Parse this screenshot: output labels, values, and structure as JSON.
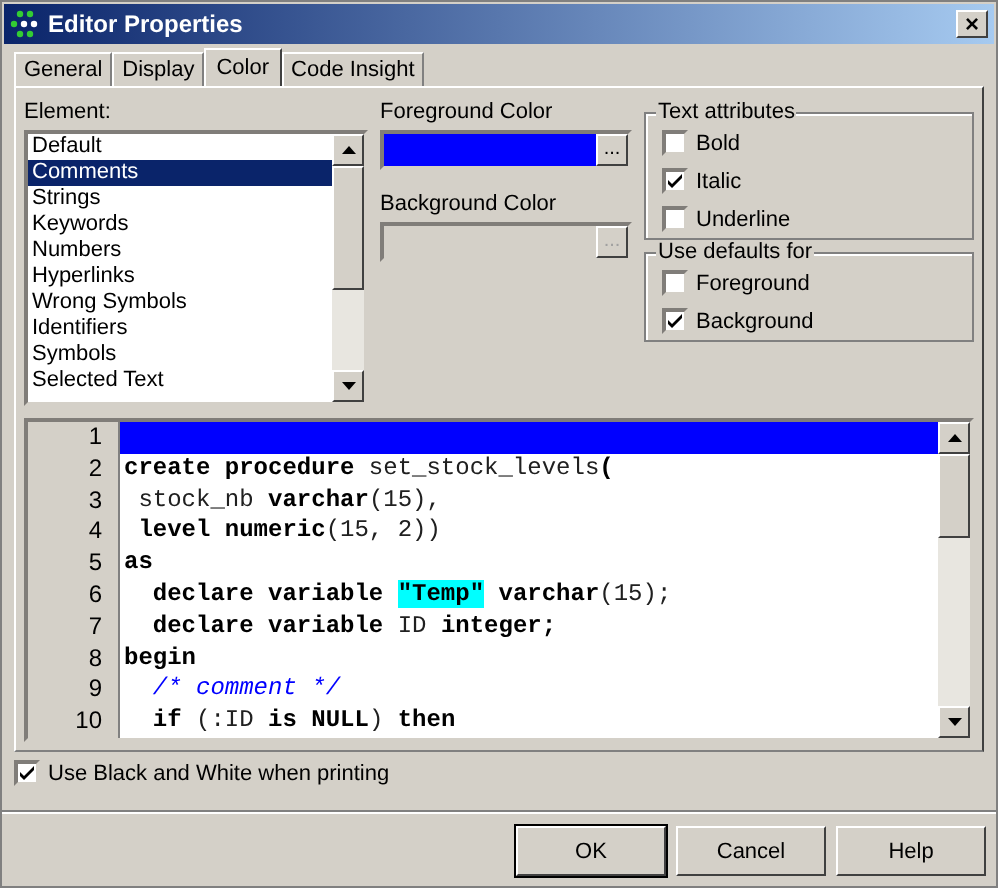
{
  "window": {
    "title": "Editor Properties",
    "close": "×"
  },
  "tabs": [
    {
      "label": "General",
      "selected": false
    },
    {
      "label": "Display",
      "selected": false
    },
    {
      "label": "Color",
      "selected": true
    },
    {
      "label": "Code Insight",
      "selected": false
    }
  ],
  "element": {
    "label": "Element:",
    "items": [
      {
        "label": "Default",
        "selected": false
      },
      {
        "label": "Comments",
        "selected": true
      },
      {
        "label": "Strings",
        "selected": false
      },
      {
        "label": "Keywords",
        "selected": false
      },
      {
        "label": "Numbers",
        "selected": false
      },
      {
        "label": "Hyperlinks",
        "selected": false
      },
      {
        "label": "Wrong Symbols",
        "selected": false
      },
      {
        "label": "Identifiers",
        "selected": false
      },
      {
        "label": "Symbols",
        "selected": false
      },
      {
        "label": "Selected Text",
        "selected": false
      }
    ]
  },
  "colors": [
    {
      "label": "Foreground Color",
      "color": "#0000ff",
      "disabled": false,
      "button": "..."
    },
    {
      "label": "Background Color",
      "disabled": true,
      "button": "..."
    }
  ],
  "groups": [
    {
      "title": "Text attributes",
      "options": [
        {
          "label": "Bold",
          "checked": false
        },
        {
          "label": "Italic",
          "checked": true
        },
        {
          "label": "Underline",
          "checked": false
        }
      ]
    },
    {
      "title": "Use defaults for",
      "options": [
        {
          "label": "Foreground",
          "checked": false
        },
        {
          "label": "Background",
          "checked": true
        }
      ]
    }
  ],
  "code": [
    {
      "number": "1",
      "selected": true
    },
    {
      "number": "2",
      "selected": false,
      "tokens": [
        {
          "kind": "keyword",
          "text": "create procedure "
        },
        {
          "kind": "ident",
          "text": "set_stock_levels"
        },
        {
          "kind": "keyword",
          "text": "("
        }
      ]
    },
    {
      "number": "3",
      "selected": false,
      "tokens": [
        {
          "kind": "ident",
          "text": " stock_nb "
        },
        {
          "kind": "keyword",
          "text": "varchar"
        },
        {
          "kind": "ident",
          "text": "(15),"
        }
      ]
    },
    {
      "number": "4",
      "selected": false,
      "tokens": [
        {
          "kind": "keyword",
          "text": " level numeric"
        },
        {
          "kind": "ident",
          "text": "(15, 2))"
        }
      ]
    },
    {
      "number": "5",
      "selected": false,
      "tokens": [
        {
          "kind": "keyword",
          "text": "as"
        }
      ]
    },
    {
      "number": "6",
      "selected": false,
      "tokens": [
        {
          "kind": "keyword",
          "text": "  declare variable "
        },
        {
          "kind": "string",
          "text": "\"Temp\""
        },
        {
          "kind": "keyword",
          "text": " varchar"
        },
        {
          "kind": "ident",
          "text": "(15);"
        }
      ]
    },
    {
      "number": "7",
      "selected": false,
      "tokens": [
        {
          "kind": "keyword",
          "text": "  declare variable "
        },
        {
          "kind": "ident",
          "text": "ID "
        },
        {
          "kind": "keyword",
          "text": "integer;"
        }
      ]
    },
    {
      "number": "8",
      "selected": false,
      "tokens": [
        {
          "kind": "keyword",
          "text": "begin"
        }
      ]
    },
    {
      "number": "9",
      "selected": false,
      "tokens": [
        {
          "kind": "comment",
          "text": "  /* comment */"
        }
      ]
    },
    {
      "number": "10",
      "selected": false,
      "tokens": [
        {
          "kind": "keyword",
          "text": "  if "
        },
        {
          "kind": "ident",
          "text": "(:ID "
        },
        {
          "kind": "keyword",
          "text": "is NULL"
        },
        {
          "kind": "ident",
          "text": ") "
        },
        {
          "kind": "keyword",
          "text": "then"
        }
      ]
    }
  ],
  "print_bw": {
    "label": "Use Black and White when printing",
    "checked": true
  },
  "buttons": [
    {
      "label": "OK",
      "default": true
    },
    {
      "label": "Cancel",
      "default": false
    },
    {
      "label": "Help",
      "default": false
    }
  ]
}
